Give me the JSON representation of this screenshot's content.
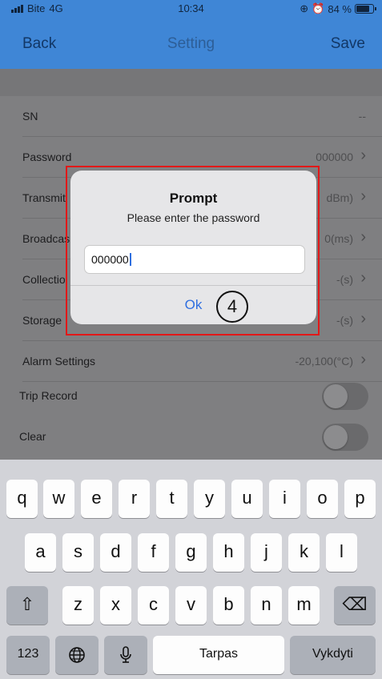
{
  "status": {
    "carrier": "Bite",
    "network": "4G",
    "time": "10:34",
    "battery": "84 %"
  },
  "nav": {
    "back": "Back",
    "title": "Setting",
    "save": "Save"
  },
  "rows": [
    {
      "label": "SN",
      "value": "--"
    },
    {
      "label": "Password",
      "value": "000000"
    },
    {
      "label": "Transmit",
      "value": "dBm)"
    },
    {
      "label": "Broadcas",
      "value": "0(ms)"
    },
    {
      "label": "Collectio",
      "value": "-(s)"
    },
    {
      "label": "Storage I",
      "value": "-(s)"
    },
    {
      "label": "Alarm Settings",
      "value": "-20,100(°C)"
    },
    {
      "label": "Trip Record"
    },
    {
      "label": "Clear"
    }
  ],
  "dialog": {
    "title": "Prompt",
    "message": "Please enter the password",
    "input_value": "000000",
    "ok": "Ok",
    "step_marker": "4"
  },
  "keyboard": {
    "row1": [
      "q",
      "w",
      "e",
      "r",
      "t",
      "y",
      "u",
      "i",
      "o",
      "p"
    ],
    "row2": [
      "a",
      "s",
      "d",
      "f",
      "g",
      "h",
      "j",
      "k",
      "l"
    ],
    "row3": [
      "z",
      "x",
      "c",
      "v",
      "b",
      "n",
      "m"
    ],
    "numbers_key": "123",
    "space_label": "Tarpas",
    "return_label": "Vykdyti"
  },
  "icons": {
    "chevron": "›",
    "shift": "⇧",
    "delete": "⌫",
    "globe": "globe-icon",
    "mic": "microphone-icon"
  }
}
